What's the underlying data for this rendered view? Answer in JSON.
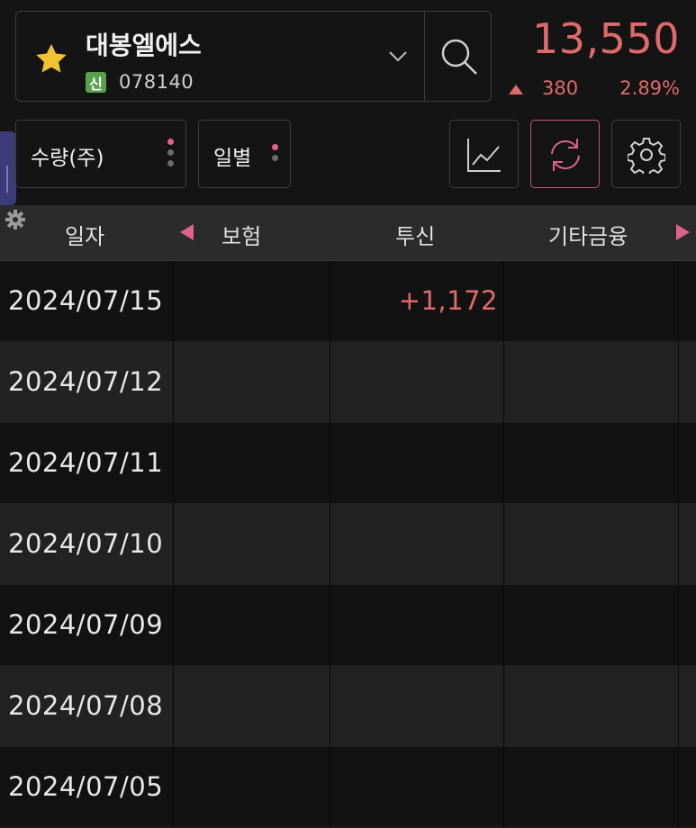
{
  "stock": {
    "name": "대봉엘에스",
    "badge": "신",
    "code": "078140",
    "price": "13,550",
    "change": "380",
    "change_rate": "2.89%",
    "up_color": "#e06a6a"
  },
  "controls": {
    "unit_label": "수량(주)",
    "period_label": "일별",
    "icons": [
      "chart-icon",
      "refresh-icon",
      "settings-icon"
    ]
  },
  "table": {
    "headers": [
      "일자",
      "보험",
      "투신",
      "기타금융"
    ],
    "rows": [
      {
        "date": "2024/07/15",
        "insurance": "",
        "trust": "+1,172",
        "other_finance": ""
      },
      {
        "date": "2024/07/12",
        "insurance": "",
        "trust": "",
        "other_finance": ""
      },
      {
        "date": "2024/07/11",
        "insurance": "",
        "trust": "",
        "other_finance": ""
      },
      {
        "date": "2024/07/10",
        "insurance": "",
        "trust": "",
        "other_finance": ""
      },
      {
        "date": "2024/07/09",
        "insurance": "",
        "trust": "",
        "other_finance": ""
      },
      {
        "date": "2024/07/08",
        "insurance": "",
        "trust": "",
        "other_finance": ""
      },
      {
        "date": "2024/07/05",
        "insurance": "",
        "trust": "",
        "other_finance": ""
      }
    ]
  }
}
